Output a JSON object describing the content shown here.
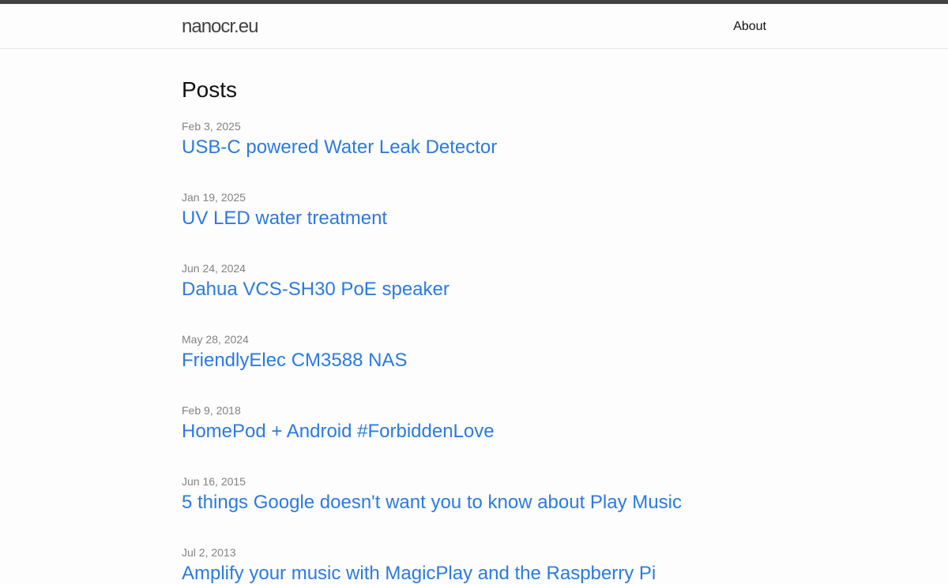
{
  "header": {
    "site_title": "nanocr.eu",
    "nav": [
      {
        "label": "About"
      }
    ]
  },
  "main": {
    "heading": "Posts",
    "posts": [
      {
        "date": "Feb 3, 2025",
        "title": "USB-C powered Water Leak Detector"
      },
      {
        "date": "Jan 19, 2025",
        "title": "UV LED water treatment"
      },
      {
        "date": "Jun 24, 2024",
        "title": "Dahua VCS-SH30 PoE speaker"
      },
      {
        "date": "May 28, 2024",
        "title": "FriendlyElec CM3588 NAS"
      },
      {
        "date": "Feb 9, 2018",
        "title": "HomePod + Android #ForbiddenLove"
      },
      {
        "date": "Jun 16, 2015",
        "title": "5 things Google doesn't want you to know about Play Music"
      },
      {
        "date": "Jul 2, 2013",
        "title": "Amplify your music with MagicPlay and the Raspberry Pi"
      }
    ]
  },
  "colors": {
    "link": "#2a7ae2",
    "meta": "#828282",
    "top_bar": "#424242",
    "background": "#fdfdfd"
  }
}
